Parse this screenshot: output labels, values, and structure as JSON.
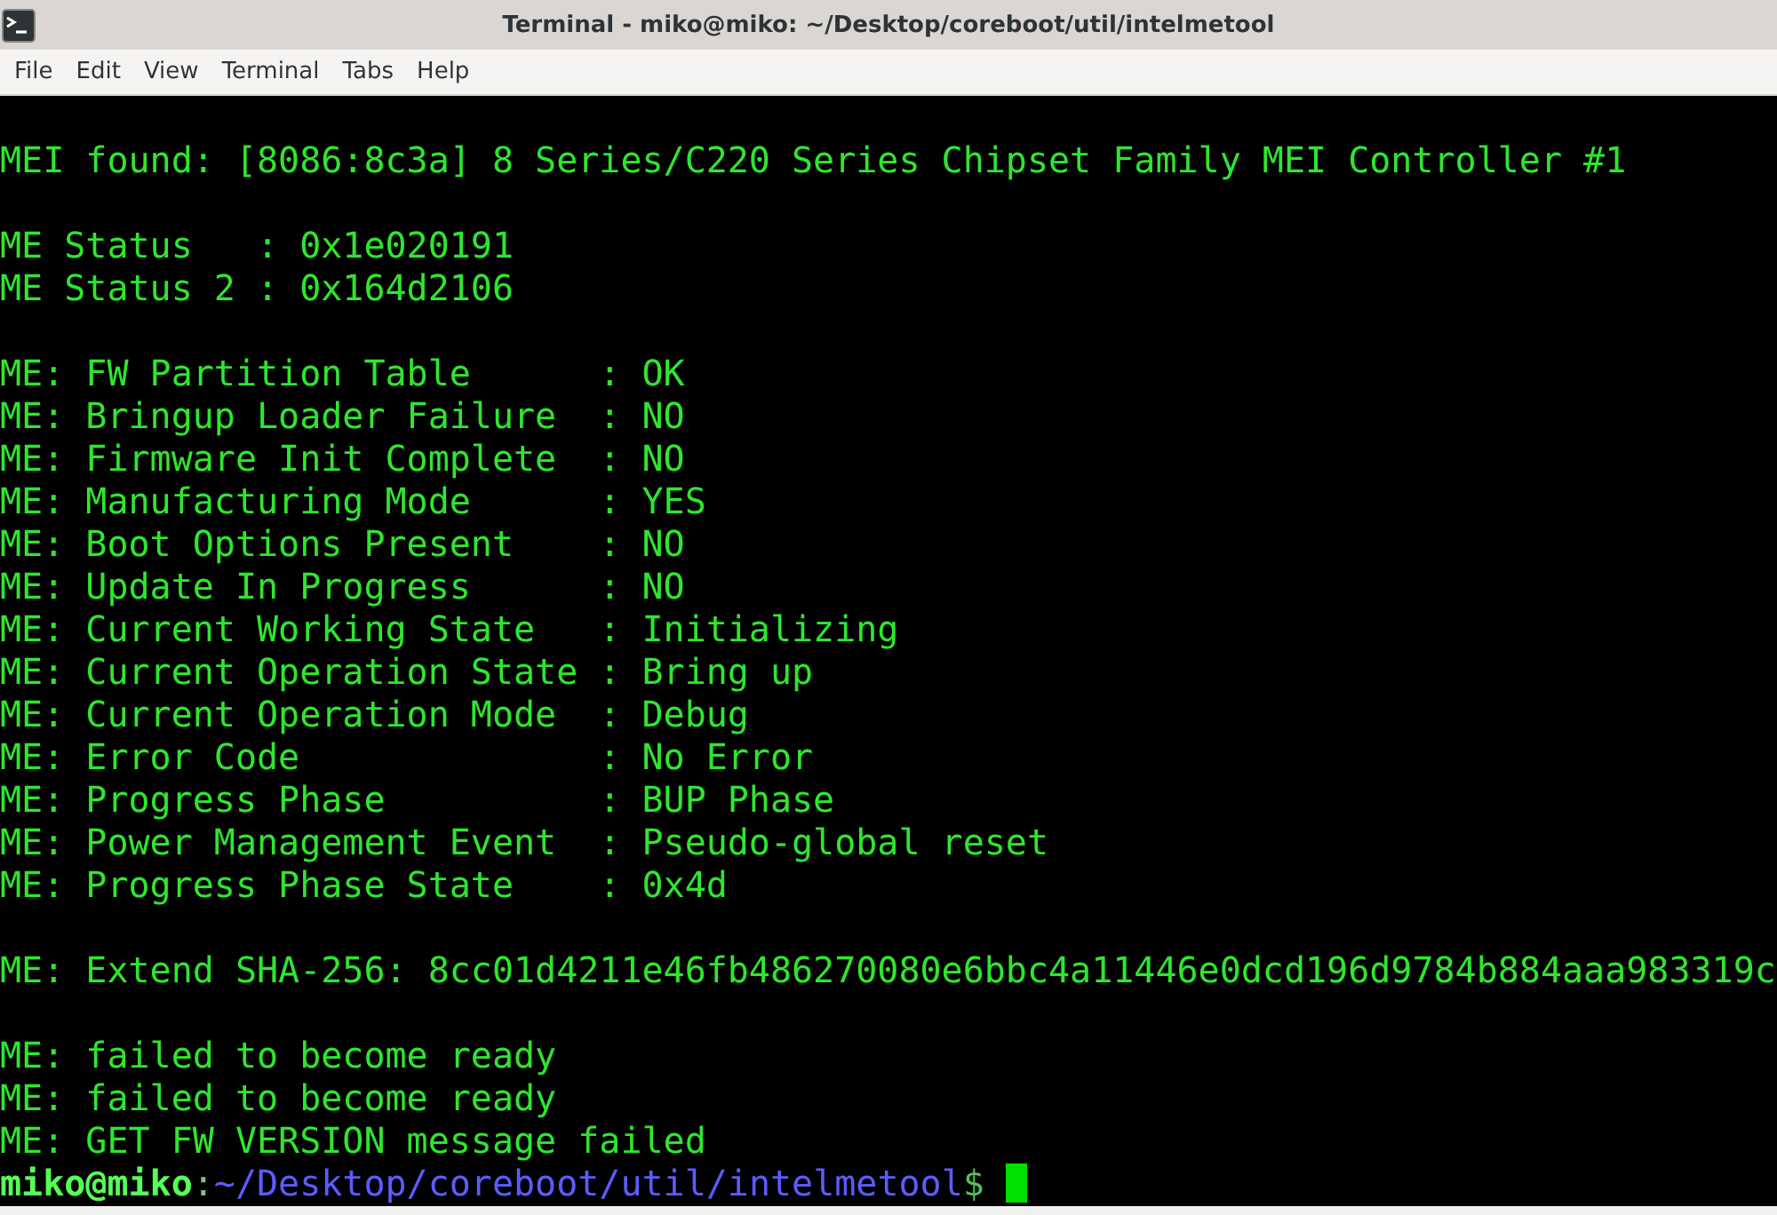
{
  "window": {
    "title": "Terminal - miko@miko: ~/Desktop/coreboot/util/intelmetool"
  },
  "menu": [
    "File",
    "Edit",
    "View",
    "Terminal",
    "Tabs",
    "Help"
  ],
  "output_blocks": [
    [
      "MEI found: [8086:8c3a] 8 Series/C220 Series Chipset Family MEI Controller #1"
    ],
    [
      "ME Status   : 0x1e020191",
      "ME Status 2 : 0x164d2106"
    ],
    [
      "ME: FW Partition Table      : OK",
      "ME: Bringup Loader Failure  : NO",
      "ME: Firmware Init Complete  : NO",
      "ME: Manufacturing Mode      : YES",
      "ME: Boot Options Present    : NO",
      "ME: Update In Progress      : NO",
      "ME: Current Working State   : Initializing",
      "ME: Current Operation State : Bring up",
      "ME: Current Operation Mode  : Debug",
      "ME: Error Code              : No Error",
      "ME: Progress Phase          : BUP Phase",
      "ME: Power Management Event  : Pseudo-global reset",
      "ME: Progress Phase State    : 0x4d"
    ],
    [
      "ME: Extend SHA-256: 8cc01d4211e46fb486270080e6bbc4a11446e0dcd196d9784b884aaa983319c"
    ],
    [
      "ME: failed to become ready",
      "ME: failed to become ready",
      "ME: GET FW VERSION message failed"
    ]
  ],
  "prompt": {
    "user_host": "miko@miko",
    "separator": ":",
    "path": "~/Desktop/coreboot/util/intelmetool",
    "symbol": "$"
  }
}
